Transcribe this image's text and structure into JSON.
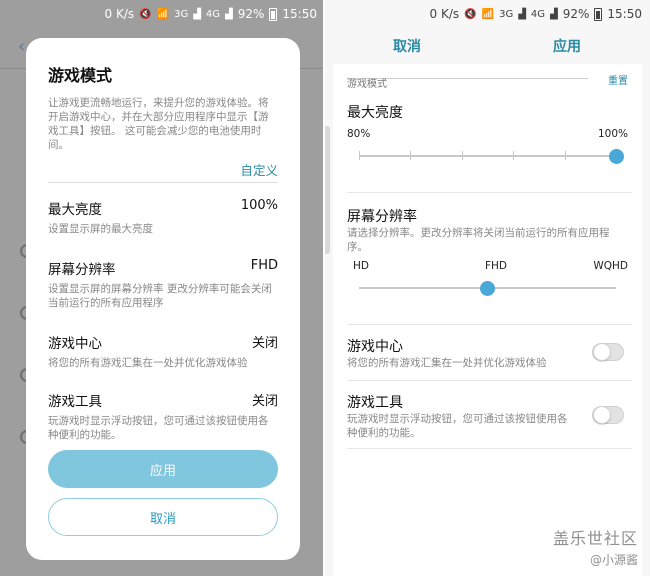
{
  "status_bar": {
    "net_speed": "0 K/s",
    "net_badge_3g": "3G",
    "net_badge_4g": "4G",
    "battery": "92%",
    "time": "15:50"
  },
  "dialog": {
    "title": "游戏模式",
    "description": "让游戏更流畅地运行，来提升您的游戏体验。将开启游戏中心，并在大部分应用程序中显示【游戏工具】按钮。 这可能会减少您的电池使用时间。",
    "customize_label": "自定义",
    "settings": [
      {
        "title": "最大亮度",
        "value": "100%",
        "desc": "设置显示屏的最大亮度"
      },
      {
        "title": "屏幕分辨率",
        "value": "FHD",
        "desc": "设置显示屏的屏幕分辨率 更改分辨率可能会关闭当前运行的所有应用程序"
      },
      {
        "title": "游戏中心",
        "value": "关闭",
        "desc": "将您的所有游戏汇集在一处并优化游戏体验"
      },
      {
        "title": "游戏工具",
        "value": "关闭",
        "desc": "玩游戏时显示浮动按钮，您可通过该按钮使用各种便利的功能。"
      }
    ],
    "apply_label": "应用",
    "cancel_label": "取消"
  },
  "custom_screen": {
    "cancel_label": "取消",
    "apply_label": "应用",
    "section_label": "游戏模式",
    "reset_label": "重置",
    "brightness": {
      "title": "最大亮度",
      "min_label": "80%",
      "max_label": "100%",
      "value_percent": 100,
      "ticks": 5
    },
    "resolution": {
      "title": "屏幕分辨率",
      "desc": "请选择分辨率。更改分辨率将关闭当前运行的所有应用程序。",
      "options": [
        "HD",
        "FHD",
        "WQHD"
      ],
      "selected": "FHD"
    },
    "game_center": {
      "title": "游戏中心",
      "desc": "将您的所有游戏汇集在一处并优化游戏体验",
      "enabled": false
    },
    "game_tools": {
      "title": "游戏工具",
      "desc": "玩游戏时显示浮动按钮，您可通过该按钮使用各种便利的功能。",
      "enabled": false
    }
  },
  "watermark": {
    "brand": "盖乐世社区",
    "author": "@小源酱"
  },
  "colors": {
    "accent": "#2a8aa5",
    "slider_thumb": "#4aa8d8",
    "apply_button": "#7fc6de",
    "overlay": "#9e9e9e"
  }
}
